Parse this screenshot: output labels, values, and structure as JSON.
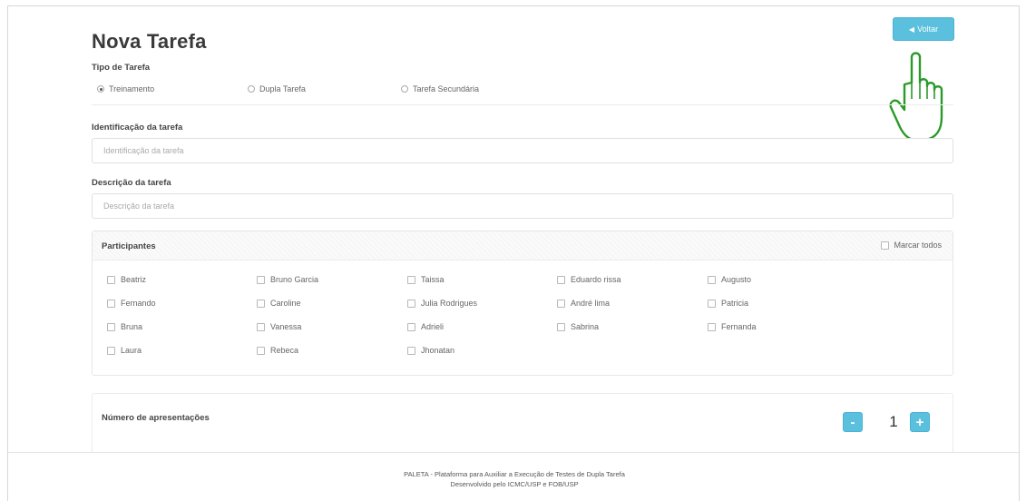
{
  "page": {
    "title": "Nova Tarefa"
  },
  "header": {
    "back_label": "Voltar"
  },
  "task_type": {
    "label": "Tipo de Tarefa",
    "options": [
      {
        "label": "Treinamento",
        "selected": true
      },
      {
        "label": "Dupla Tarefa",
        "selected": false
      },
      {
        "label": "Tarefa Secundária",
        "selected": false
      }
    ]
  },
  "identification": {
    "label": "Identificação da tarefa",
    "placeholder": "Identificação da tarefa",
    "value": ""
  },
  "description": {
    "label": "Descrição da tarefa",
    "placeholder": "Descrição da tarefa",
    "value": ""
  },
  "participants": {
    "title": "Participantes",
    "mark_all_label": "Marcar todos",
    "columns": [
      [
        "Beatriz",
        "Fernando",
        "Bruna",
        "Laura"
      ],
      [
        "Bruno Garcia",
        "Caroline",
        "Vanessa",
        "Rebeca"
      ],
      [
        "Taissa",
        "Julia Rodrigues",
        "Adrieli",
        "Jhonatan"
      ],
      [
        "Eduardo rissa",
        "André lima",
        "Sabrina"
      ],
      [
        "Augusto",
        "Patricia",
        "Fernanda"
      ]
    ]
  },
  "presentations": {
    "label": "Número de apresentações",
    "value": "1",
    "minus_label": "-",
    "plus_label": "+"
  },
  "footer": {
    "line1": "PALETA - Plataforma para Auxiliar a Execução de Testes de Dupla Tarefa",
    "line2": "Desenvolvido pelo ICMC/USP e FOB/USP"
  },
  "icons": {
    "back": "caret-left-icon",
    "pointer": "hand-pointer-icon"
  },
  "colors": {
    "accent": "#5bc0de",
    "hand_outline": "#2a9a2a"
  }
}
